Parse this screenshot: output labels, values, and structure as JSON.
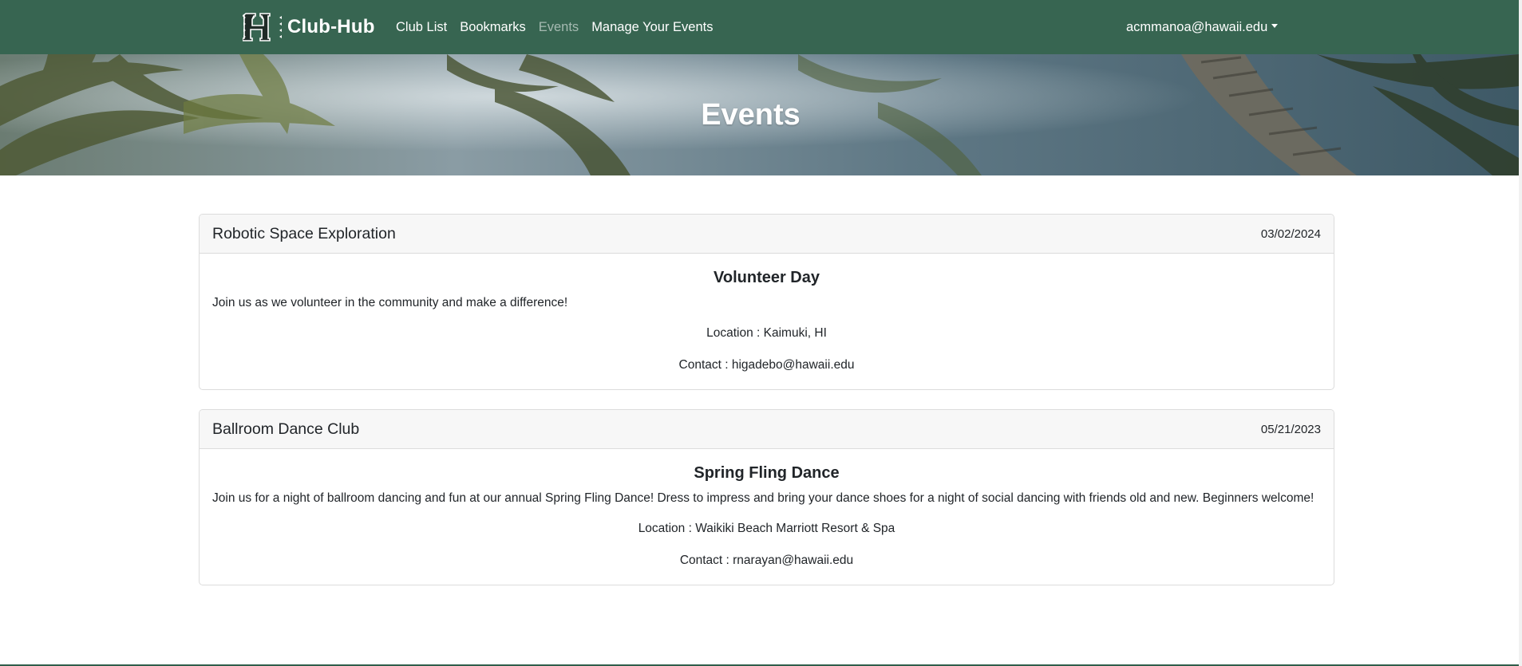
{
  "brand": {
    "name": "Club-Hub",
    "logo_icon": "hawaii-h-logo-icon"
  },
  "nav": {
    "links": [
      {
        "label": "Club List",
        "active": false
      },
      {
        "label": "Bookmarks",
        "active": false
      },
      {
        "label": "Events",
        "active": true
      },
      {
        "label": "Manage Your Events",
        "active": false
      }
    ],
    "user_email": "acmmanoa@hawaii.edu"
  },
  "hero": {
    "title": "Events"
  },
  "events": [
    {
      "club": "Robotic Space Exploration",
      "date": "03/02/2024",
      "title": "Volunteer Day",
      "description": "Join us as we volunteer in the community and make a difference!",
      "location": "Location : Kaimuki, HI",
      "contact": "Contact : higadebo@hawaii.edu"
    },
    {
      "club": "Ballroom Dance Club",
      "date": "05/21/2023",
      "title": "Spring Fling Dance",
      "description": "Join us for a night of ballroom dancing and fun at our annual Spring Fling Dance! Dress to impress and bring your dance shoes for a night of social dancing with friends old and new. Beginners welcome!",
      "location": "Location : Waikiki Beach Marriott Resort & Spa",
      "contact": "Contact : rnarayan@hawaii.edu"
    }
  ],
  "colors": {
    "navbar": "#376551",
    "card_header": "#f7f7f7",
    "card_border": "#dcdcdc",
    "inactive_link": "rgba(255,255,255,0.55)"
  }
}
